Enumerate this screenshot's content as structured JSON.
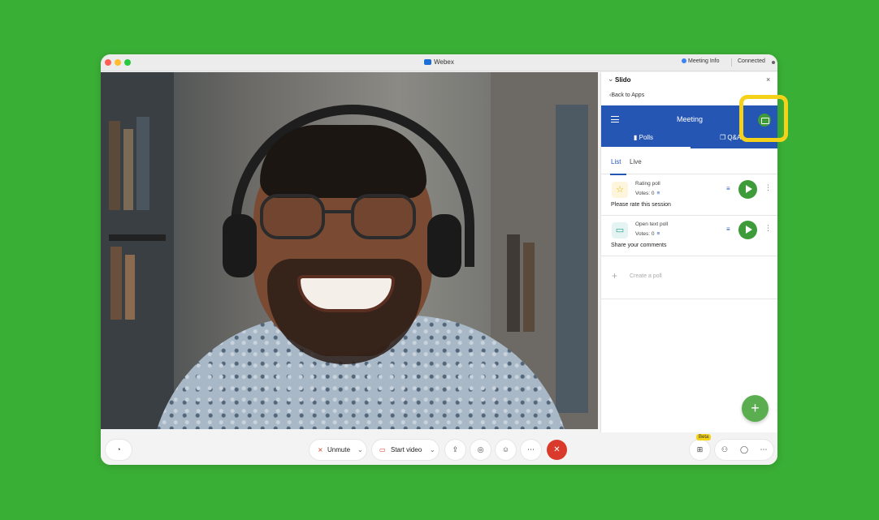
{
  "app": {
    "title": "Webex",
    "meeting_info": "Meeting Info",
    "status": "Connected"
  },
  "panel": {
    "title": "Slido",
    "back": "Back to Apps",
    "header_title": "Meeting",
    "tabs": [
      {
        "label": "Polls"
      },
      {
        "label": "Q&A"
      }
    ],
    "sub_tabs": [
      {
        "label": "List"
      },
      {
        "label": "Live"
      }
    ],
    "polls": [
      {
        "type": "Rating poll",
        "votes": "Votes: 0",
        "question": "Please rate this session",
        "icon": "star-icon"
      },
      {
        "type": "Open text poll",
        "votes": "Votes: 0",
        "question": "Share your comments",
        "icon": "comment-icon"
      }
    ],
    "create_label": "Create a poll"
  },
  "toolbar": {
    "unmute": "Unmute",
    "start_video": "Start video",
    "beta": "Beta"
  },
  "colors": {
    "background": "#3aaf36",
    "slido_header": "#2656b3",
    "accent_green": "#3d9b3a",
    "highlight": "#f5d21a",
    "end_call": "#d93a2b"
  }
}
